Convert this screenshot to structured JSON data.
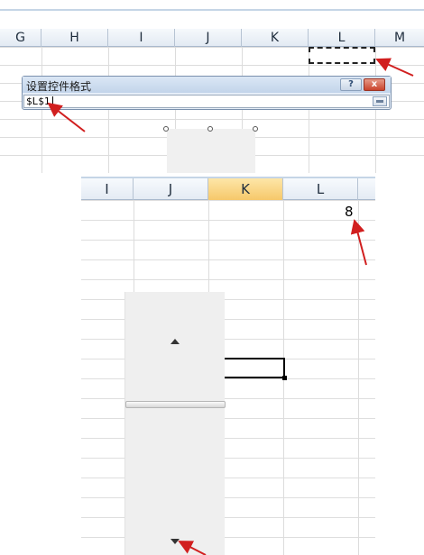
{
  "top_sheet": {
    "columns": [
      "G",
      "H",
      "I",
      "J",
      "K",
      "L",
      "M"
    ]
  },
  "dialog": {
    "title": "设置控件格式",
    "help_button": "?",
    "close_button": "x",
    "cell_link": "$L$1"
  },
  "bottom_sheet": {
    "columns": [
      "I",
      "J",
      "K",
      "L"
    ],
    "active_column": "K",
    "cell_l1_value": "8"
  },
  "colors": {
    "arrow": "#d11f1f",
    "active_header": "#f6c86a",
    "dialog_title_bg": "#c2d4ea"
  },
  "icons": [
    "help-icon",
    "close-icon",
    "collapse-dialog-icon",
    "scroll-up-icon",
    "scroll-down-icon",
    "annotation-arrow"
  ]
}
